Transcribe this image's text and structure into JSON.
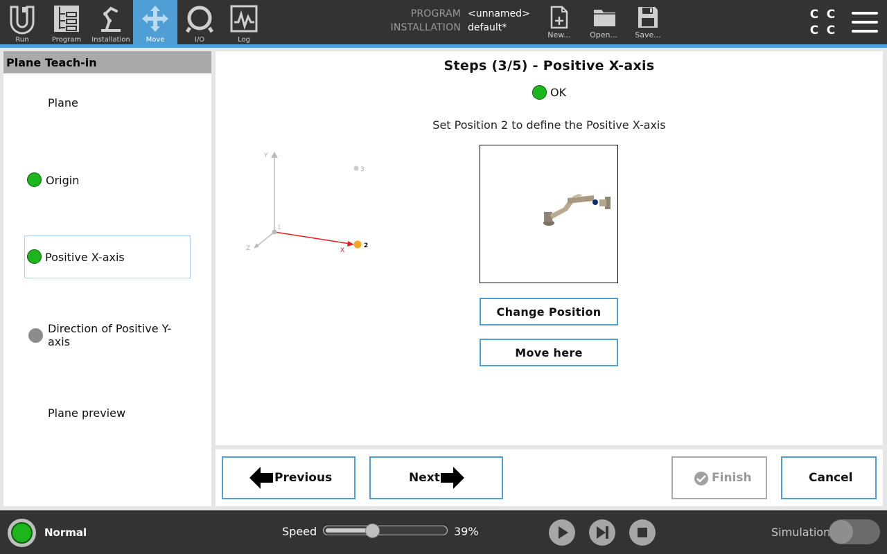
{
  "topbar": {
    "tabs": [
      {
        "label": "Run",
        "icon": "ur-logo-icon"
      },
      {
        "label": "Program",
        "icon": "program-tree-icon"
      },
      {
        "label": "Installation",
        "icon": "robot-arm-icon"
      },
      {
        "label": "Move",
        "icon": "move-arrows-icon",
        "active": true
      },
      {
        "label": "I/O",
        "icon": "io-icon"
      },
      {
        "label": "Log",
        "icon": "log-waveform-icon"
      }
    ],
    "program_label": "PROGRAM",
    "program_value": "<unnamed>",
    "installation_label": "INSTALLATION",
    "installation_value": "default*",
    "file_buttons": [
      {
        "label": "New...",
        "icon": "new-file-icon"
      },
      {
        "label": "Open...",
        "icon": "open-folder-icon"
      },
      {
        "label": "Save...",
        "icon": "save-disk-icon"
      }
    ],
    "cc_glyph": "C",
    "accent_color": "#4f9fd6"
  },
  "sidebar": {
    "title": "Plane Teach-in",
    "items": [
      {
        "label": "Plane",
        "status": "none"
      },
      {
        "label": "Origin",
        "status": "green"
      },
      {
        "label": "Positive X-axis",
        "status": "green",
        "selected": true
      },
      {
        "label": "Direction of Positive Y-axis",
        "status": "gray"
      },
      {
        "label": "Plane preview",
        "status": "none"
      }
    ]
  },
  "main": {
    "title": "Steps (3/5) - Positive X-axis",
    "status_text": "OK",
    "instruction": "Set Position 2 to define the Positive X-axis",
    "diagram": {
      "y_label": "Y",
      "z_label": "Z",
      "x_label": "X",
      "point1_label": "1",
      "point2_label": "2",
      "point3_label": "3"
    },
    "change_position_label": "Change Position",
    "move_here_label": "Move here"
  },
  "wizard": {
    "previous_label": "Previous",
    "next_label": "Next",
    "finish_label": "Finish",
    "cancel_label": "Cancel"
  },
  "footer": {
    "robot_status": "Normal",
    "speed_label": "Speed",
    "speed_percent": 39,
    "speed_text": "39%",
    "simulation_label": "Simulation",
    "simulation_on": false
  }
}
